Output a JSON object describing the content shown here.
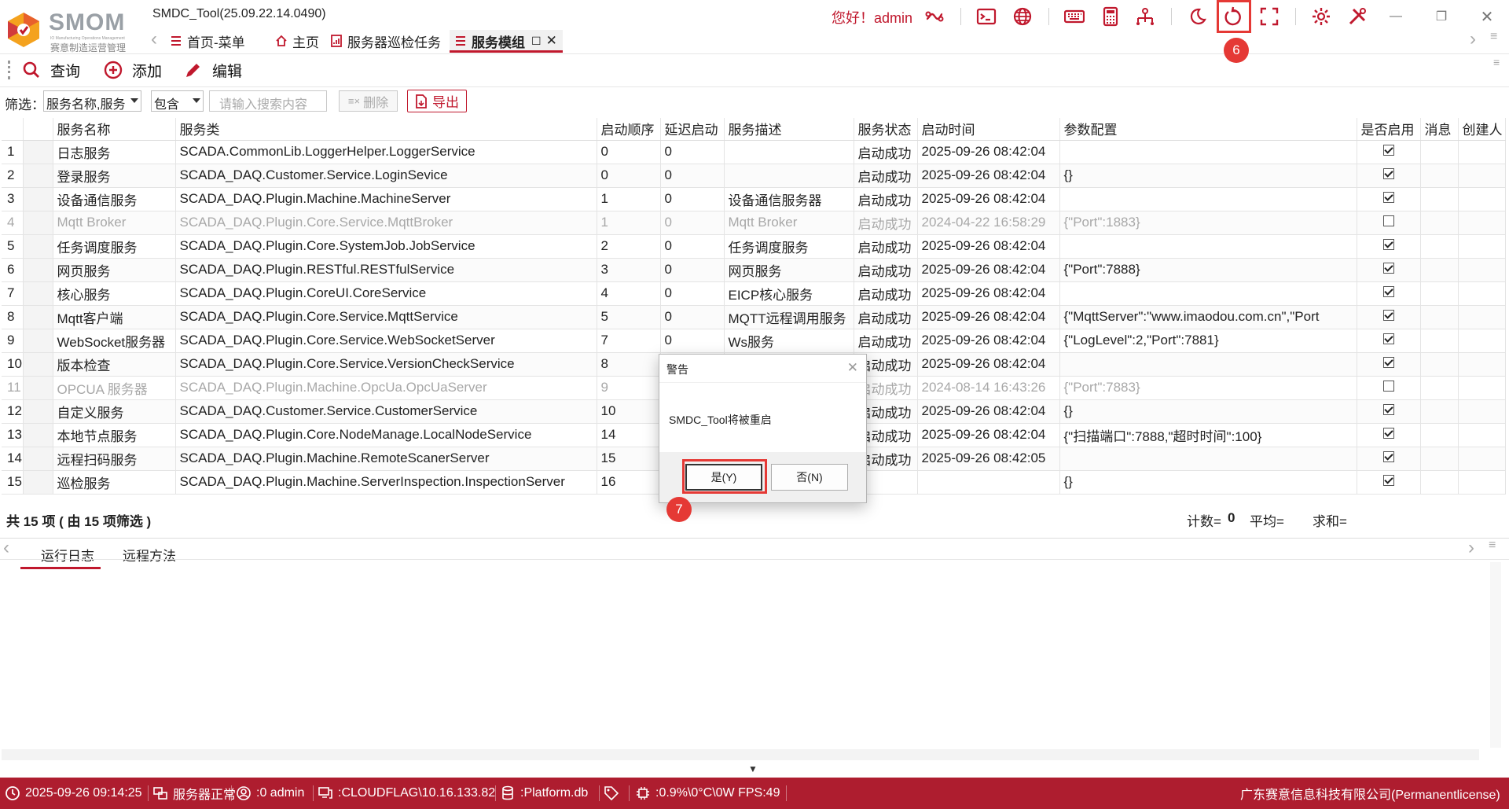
{
  "app": {
    "logo_text": "SMOM",
    "logo_sub_en": "IO Manufacturing Operations Management",
    "logo_sub_cn": "赛意制造运营管理",
    "title": "SMDC_Tool(25.09.22.14.0490)",
    "greeting": "您好！admin"
  },
  "toolbar_icons": [
    "link-icon",
    "terminal-icon",
    "globe-icon",
    "keyboard-icon",
    "calculator-icon",
    "network-icon",
    "moon-icon",
    "restart-icon",
    "fullscreen-icon",
    "settings-icon",
    "tools-icon"
  ],
  "tabs": [
    {
      "label": "首页-菜单",
      "icon": "menu-icon"
    },
    {
      "label": "主页",
      "icon": "home-icon"
    },
    {
      "label": "服务器巡检任务",
      "icon": "report-icon"
    },
    {
      "label": "服务模组",
      "icon": "menu-icon",
      "active": true
    }
  ],
  "commands": [
    {
      "label": "查询",
      "icon": "search-icon"
    },
    {
      "label": "添加",
      "icon": "add-icon"
    },
    {
      "label": "编辑",
      "icon": "edit-icon"
    }
  ],
  "filter": {
    "label": "筛选：",
    "field_value": "服务名称,服务",
    "op_value": "包含",
    "search_placeholder": "请输入搜索内容",
    "delete_label": "删除",
    "export_label": "导出"
  },
  "table": {
    "columns": [
      "服务名称",
      "服务类",
      "启动顺序",
      "延迟启动",
      "服务描述",
      "服务状态",
      "启动时间",
      "参数配置",
      "是否启用",
      "消息",
      "创建人"
    ],
    "rows": [
      {
        "no": "1",
        "name": "日志服务",
        "cls": "SCADA.CommonLib.LoggerHelper.LoggerService",
        "order": "0",
        "delay": "0",
        "desc": "",
        "status": "启动成功",
        "time": "2025-09-26 08:42:04",
        "param": "",
        "enabled": true,
        "msg": "",
        "creator": "",
        "disabled": false
      },
      {
        "no": "2",
        "name": "登录服务",
        "cls": "SCADA_DAQ.Customer.Service.LoginSevice",
        "order": "0",
        "delay": "0",
        "desc": "",
        "status": "启动成功",
        "time": "2025-09-26 08:42:04",
        "param": "{}",
        "enabled": true,
        "msg": "",
        "creator": "",
        "disabled": false
      },
      {
        "no": "3",
        "name": "设备通信服务",
        "cls": "SCADA_DAQ.Plugin.Machine.MachineServer",
        "order": "1",
        "delay": "0",
        "desc": "设备通信服务器",
        "status": "启动成功",
        "time": "2025-09-26 08:42:04",
        "param": "",
        "enabled": true,
        "msg": "",
        "creator": "",
        "disabled": false
      },
      {
        "no": "4",
        "name": "Mqtt Broker",
        "cls": "SCADA_DAQ.Plugin.Core.Service.MqttBroker",
        "order": "1",
        "delay": "0",
        "desc": "Mqtt Broker",
        "status": "启动成功",
        "time": "2024-04-22 16:58:29",
        "param": "{\"Port\":1883}",
        "enabled": false,
        "msg": "",
        "creator": "",
        "disabled": true
      },
      {
        "no": "5",
        "name": "任务调度服务",
        "cls": "SCADA_DAQ.Plugin.Core.SystemJob.JobService",
        "order": "2",
        "delay": "0",
        "desc": "任务调度服务",
        "status": "启动成功",
        "time": "2025-09-26 08:42:04",
        "param": "",
        "enabled": true,
        "msg": "",
        "creator": "",
        "disabled": false
      },
      {
        "no": "6",
        "name": "网页服务",
        "cls": "SCADA_DAQ.Plugin.RESTful.RESTfulService",
        "order": "3",
        "delay": "0",
        "desc": "网页服务",
        "status": "启动成功",
        "time": "2025-09-26 08:42:04",
        "param": "{\"Port\":7888}",
        "enabled": true,
        "msg": "",
        "creator": "",
        "disabled": false
      },
      {
        "no": "7",
        "name": "核心服务",
        "cls": "SCADA_DAQ.Plugin.CoreUI.CoreService",
        "order": "4",
        "delay": "0",
        "desc": "EICP核心服务",
        "status": "启动成功",
        "time": "2025-09-26 08:42:04",
        "param": "",
        "enabled": true,
        "msg": "",
        "creator": "",
        "disabled": false
      },
      {
        "no": "8",
        "name": "Mqtt客户端",
        "cls": "SCADA_DAQ.Plugin.Core.Service.MqttService",
        "order": "5",
        "delay": "0",
        "desc": "MQTT远程调用服务",
        "status": "启动成功",
        "time": "2025-09-26 08:42:04",
        "param": "{\"MqttServer\":\"www.imaodou.com.cn\",\"Port",
        "enabled": true,
        "msg": "",
        "creator": "",
        "disabled": false
      },
      {
        "no": "9",
        "name": "WebSocket服务器",
        "cls": "SCADA_DAQ.Plugin.Core.Service.WebSocketServer",
        "order": "7",
        "delay": "0",
        "desc": "Ws服务",
        "status": "启动成功",
        "time": "2025-09-26 08:42:04",
        "param": "{\"LogLevel\":2,\"Port\":7881}",
        "enabled": true,
        "msg": "",
        "creator": "",
        "disabled": false
      },
      {
        "no": "10",
        "name": "版本检查",
        "cls": "SCADA_DAQ.Plugin.Core.Service.VersionCheckService",
        "order": "8",
        "delay": "",
        "desc": "",
        "status": "启动成功",
        "time": "2025-09-26 08:42:04",
        "param": "",
        "enabled": true,
        "msg": "",
        "creator": "",
        "disabled": false
      },
      {
        "no": "11",
        "name": "OPCUA 服务器",
        "cls": "SCADA_DAQ.Plugin.Machine.OpcUa.OpcUaServer",
        "order": "9",
        "delay": "",
        "desc": "",
        "status": "启动成功",
        "time": "2024-08-14 16:43:26",
        "param": "{\"Port\":7883}",
        "enabled": false,
        "msg": "",
        "creator": "",
        "disabled": true
      },
      {
        "no": "12",
        "name": "自定义服务",
        "cls": "SCADA_DAQ.Customer.Service.CustomerService",
        "order": "10",
        "delay": "",
        "desc": "",
        "status": "启动成功",
        "time": "2025-09-26 08:42:04",
        "param": "{}",
        "enabled": true,
        "msg": "",
        "creator": "",
        "disabled": false
      },
      {
        "no": "13",
        "name": "本地节点服务",
        "cls": "SCADA_DAQ.Plugin.Core.NodeManage.LocalNodeService",
        "order": "14",
        "delay": "",
        "desc": "",
        "status": "启动成功",
        "time": "2025-09-26 08:42:04",
        "param": "{\"扫描端口\":7888,\"超时时间\":100}",
        "enabled": true,
        "msg": "",
        "creator": "",
        "disabled": false
      },
      {
        "no": "14",
        "name": "远程扫码服务",
        "cls": "SCADA_DAQ.Plugin.Machine.RemoteScanerServer",
        "order": "15",
        "delay": "",
        "desc": "",
        "status": "启动成功",
        "time": "2025-09-26 08:42:05",
        "param": "",
        "enabled": true,
        "msg": "",
        "creator": "",
        "disabled": false
      },
      {
        "no": "15",
        "name": "巡检服务",
        "cls": "SCADA_DAQ.Plugin.Machine.ServerInspection.InspectionServer",
        "order": "16",
        "delay": "",
        "desc": "",
        "status": "",
        "time": "",
        "param": "{}",
        "enabled": true,
        "msg": "",
        "creator": "",
        "disabled": false
      }
    ]
  },
  "summary": {
    "left": "共 15 项 ( 由 15 项筛选 )",
    "count_label": "计数=",
    "count_value": "0",
    "avg_label": "平均=",
    "sum_label": "求和="
  },
  "bottom_tabs": [
    "运行日志",
    "远程方法"
  ],
  "statusbar": {
    "datetime": "2025-09-26 09:14:25",
    "server": "服务器正常",
    "user": ":0 admin",
    "host": ":CLOUDFLAG\\10.16.133.82",
    "db": ":Platform.db",
    "perf": ":0.9%\\0°C\\0W  FPS:49",
    "company": "广东赛意信息科技有限公司(Permanentlicense)"
  },
  "dialog": {
    "title": "警告",
    "message": "SMDC_Tool将被重启",
    "yes_label": "是(Y)",
    "no_label": "否(N)"
  },
  "annotations": {
    "badge_restart": "6",
    "badge_yes": "7",
    "color": "#e53935"
  },
  "colors": {
    "brand": "#c0182d",
    "statusbar": "#ae1d2f"
  }
}
